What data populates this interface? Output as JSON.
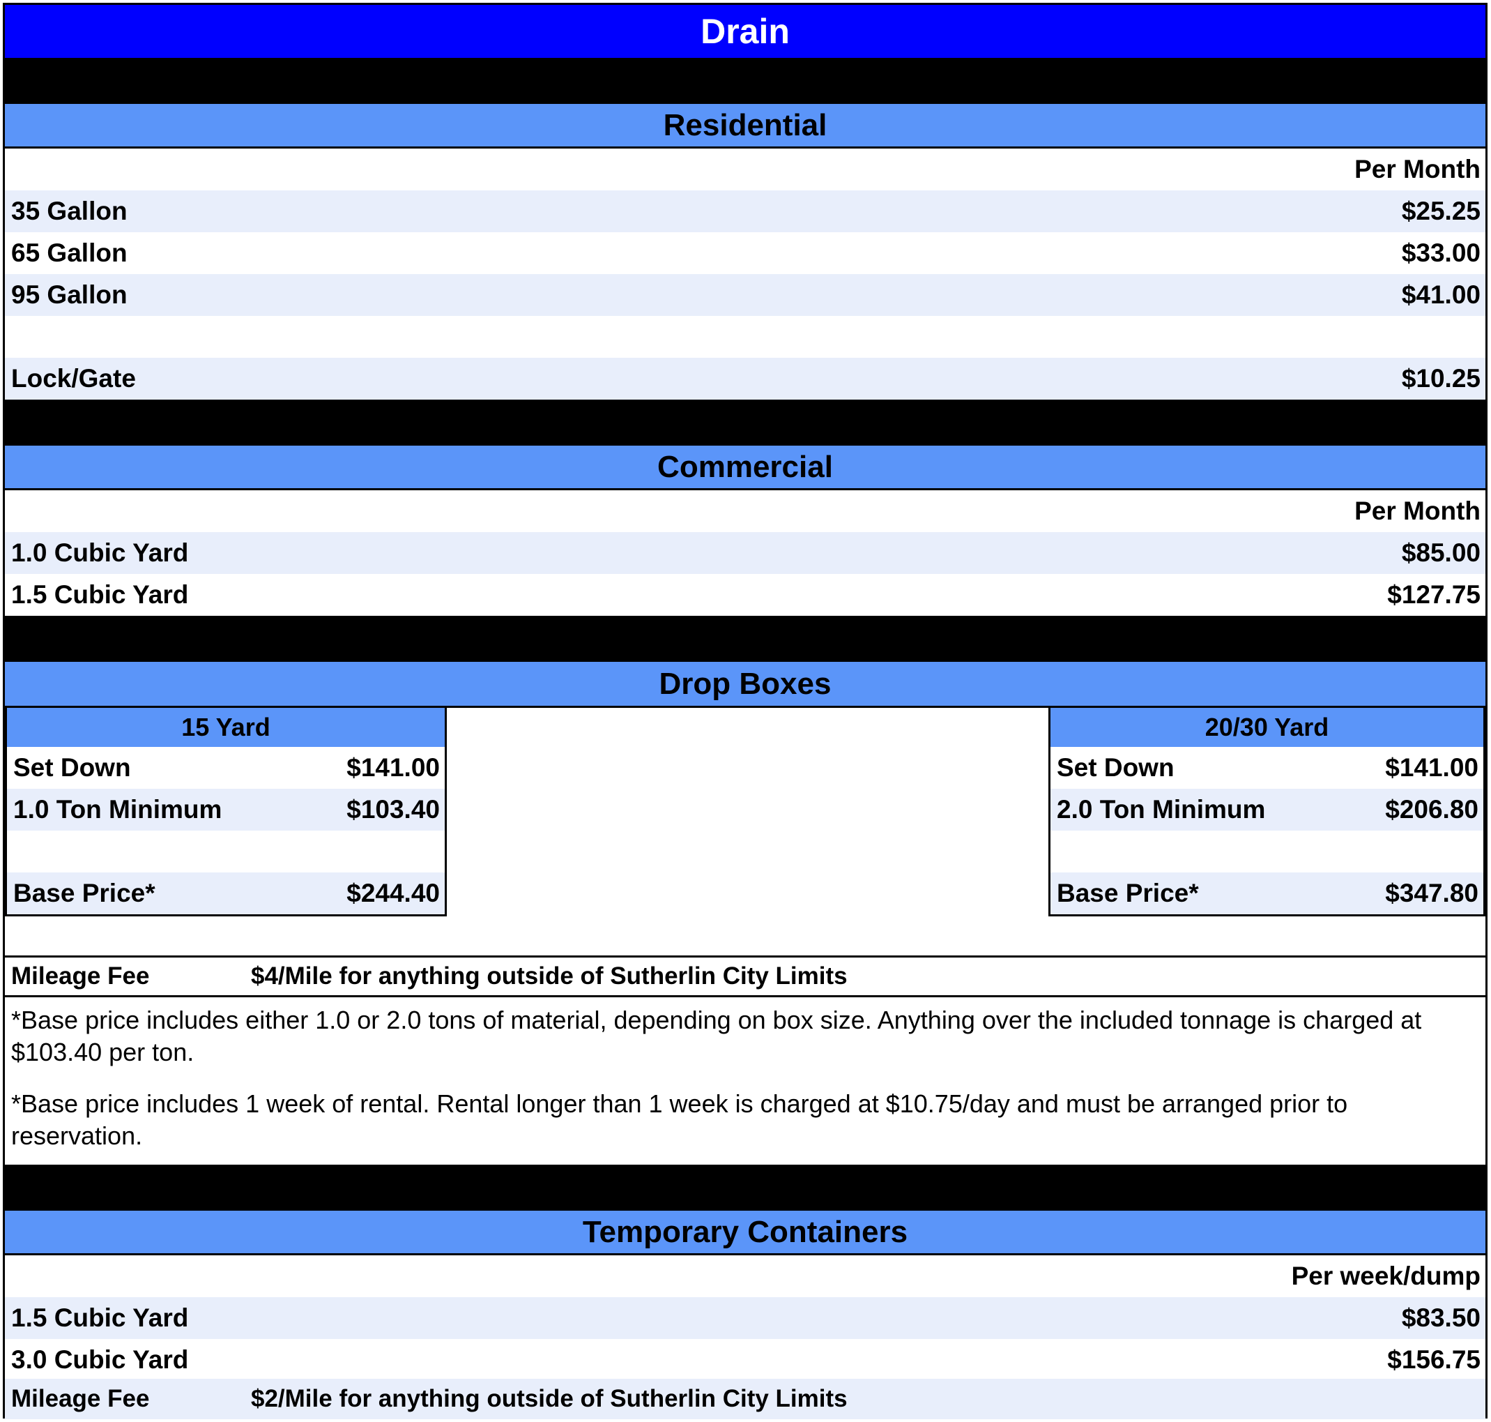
{
  "title": "Drain",
  "residential": {
    "heading": "Residential",
    "column_header": "Per Month",
    "rows": [
      {
        "label": "35 Gallon",
        "price": "$25.25"
      },
      {
        "label": "65 Gallon",
        "price": "$33.00"
      },
      {
        "label": "95 Gallon",
        "price": "$41.00"
      },
      {
        "label": "Lock/Gate",
        "price": "$10.25"
      }
    ]
  },
  "commercial": {
    "heading": "Commercial",
    "column_header": "Per Month",
    "rows": [
      {
        "label": "1.0 Cubic Yard",
        "price": "$85.00"
      },
      {
        "label": "1.5 Cubic Yard",
        "price": "$127.75"
      }
    ]
  },
  "drop_boxes": {
    "heading": "Drop Boxes",
    "boxes": [
      {
        "title": "15 Yard",
        "rows": [
          {
            "label": "Set Down",
            "price": "$141.00"
          },
          {
            "label": "1.0 Ton Minimum",
            "price": "$103.40"
          },
          {
            "label": "Base Price*",
            "price": "$244.40"
          }
        ]
      },
      {
        "title": "20/30 Yard",
        "rows": [
          {
            "label": "Set Down",
            "price": "$141.00"
          },
          {
            "label": "2.0 Ton Minimum",
            "price": "$206.80"
          },
          {
            "label": "Base Price*",
            "price": "$347.80"
          }
        ]
      }
    ],
    "mileage_label": "Mileage Fee",
    "mileage_text": "$4/Mile for anything outside of Sutherlin City Limits",
    "notes": [
      "*Base price includes either 1.0 or 2.0 tons of material, depending on box size. Anything over the included tonnage is charged at $103.40 per ton.",
      "*Base price includes 1 week of rental. Rental longer than 1 week is charged at $10.75/day and must be arranged prior to reservation."
    ]
  },
  "temporary": {
    "heading": "Temporary Containers",
    "column_header": "Per week/dump",
    "rows": [
      {
        "label": "1.5 Cubic Yard",
        "price": "$83.50"
      },
      {
        "label": "3.0 Cubic Yard",
        "price": "$156.75"
      }
    ],
    "mileage_label": "Mileage Fee",
    "mileage_text": "$2/Mile for anything outside of Sutherlin City Limits"
  },
  "colors": {
    "title_bar": "#0000ff",
    "section_header": "#5b95f9",
    "alt_row": "#e8eefb",
    "divider": "#000000"
  }
}
